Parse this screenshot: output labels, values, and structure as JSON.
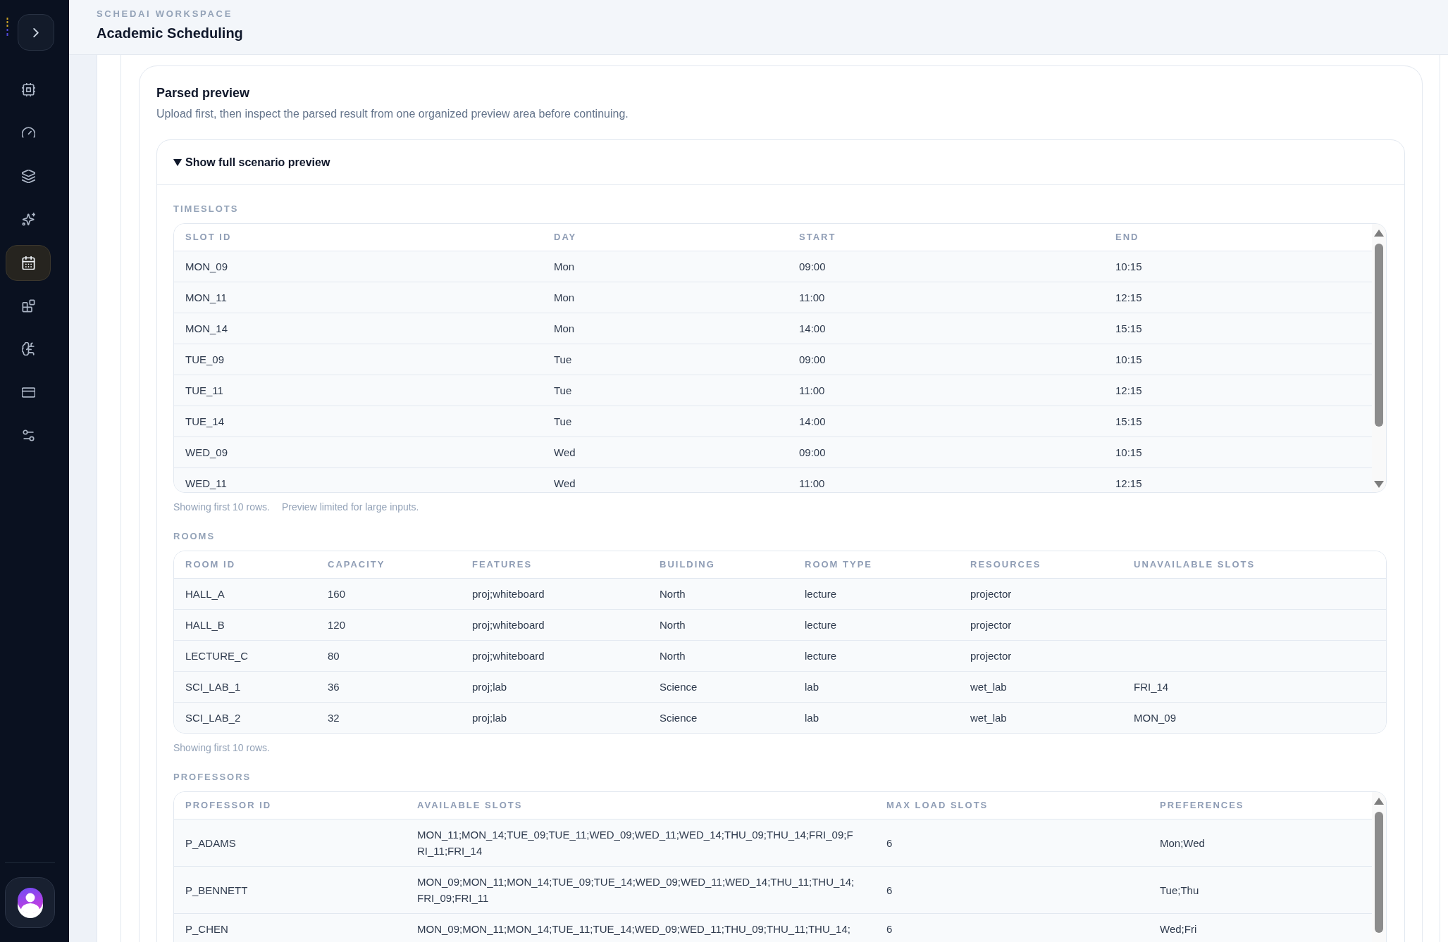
{
  "sidebar": {
    "items": [
      {
        "kind": "chip",
        "selected": false
      },
      {
        "kind": "gauge",
        "selected": false
      },
      {
        "kind": "layers",
        "selected": false
      },
      {
        "kind": "sparkles",
        "selected": false
      },
      {
        "kind": "calendar",
        "selected": true
      },
      {
        "kind": "blocks",
        "selected": false
      },
      {
        "kind": "brain",
        "selected": false
      },
      {
        "kind": "card",
        "selected": false
      },
      {
        "kind": "sliders",
        "selected": false
      }
    ]
  },
  "header": {
    "eyebrow": "SCHEDAI WORKSPACE",
    "title": "Academic Scheduling"
  },
  "preview": {
    "title": "Parsed preview",
    "subtitle": "Upload first, then inspect the parsed result from one organized preview area before continuing.",
    "toggle": {
      "label": "Show full scenario preview",
      "expanded": true
    },
    "sections": [
      {
        "title": "TIMESLOTS",
        "scrollable": true,
        "columns": [
          "SLOT ID",
          "DAY",
          "START",
          "END"
        ],
        "rows": [
          [
            "MON_09",
            "Mon",
            "09:00",
            "10:15"
          ],
          [
            "MON_11",
            "Mon",
            "11:00",
            "12:15"
          ],
          [
            "MON_14",
            "Mon",
            "14:00",
            "15:15"
          ],
          [
            "TUE_09",
            "Tue",
            "09:00",
            "10:15"
          ],
          [
            "TUE_11",
            "Tue",
            "11:00",
            "12:15"
          ],
          [
            "TUE_14",
            "Tue",
            "14:00",
            "15:15"
          ],
          [
            "WED_09",
            "Wed",
            "09:00",
            "10:15"
          ],
          [
            "WED_11",
            "Wed",
            "11:00",
            "12:15"
          ]
        ],
        "notes": [
          "Showing first 10 rows.",
          "Preview limited for large inputs."
        ]
      },
      {
        "title": "ROOMS",
        "scrollable": false,
        "columns": [
          "ROOM ID",
          "CAPACITY",
          "FEATURES",
          "BUILDING",
          "ROOM TYPE",
          "RESOURCES",
          "UNAVAILABLE SLOTS"
        ],
        "rows": [
          [
            "HALL_A",
            "160",
            "proj;whiteboard",
            "North",
            "lecture",
            "projector",
            null
          ],
          [
            "HALL_B",
            "120",
            "proj;whiteboard",
            "North",
            "lecture",
            "projector",
            null
          ],
          [
            "LECTURE_C",
            "80",
            "proj;whiteboard",
            "North",
            "lecture",
            "projector",
            null
          ],
          [
            "SCI_LAB_1",
            "36",
            "proj;lab",
            "Science",
            "lab",
            "wet_lab",
            "FRI_14"
          ],
          [
            "SCI_LAB_2",
            "32",
            "proj;lab",
            "Science",
            "lab",
            "wet_lab",
            "MON_09"
          ]
        ],
        "notes": [
          "Showing first 10 rows."
        ]
      },
      {
        "title": "PROFESSORS",
        "scrollable": true,
        "columns": [
          "PROFESSOR ID",
          "AVAILABLE SLOTS",
          "MAX LOAD SLOTS",
          "PREFERENCES"
        ],
        "rows": [
          [
            "P_ADAMS",
            "MON_11;MON_14;TUE_09;TUE_11;WED_09;WED_11;WED_14;THU_09;THU_14;FRI_09;FRI_11;FRI_14",
            "6",
            "Mon;Wed"
          ],
          [
            "P_BENNETT",
            "MON_09;MON_11;MON_14;TUE_09;TUE_14;WED_09;WED_11;WED_14;THU_11;THU_14;FRI_09;FRI_11",
            "6",
            "Tue;Thu"
          ],
          [
            "P_CHEN",
            "MON_09;MON_11;MON_14;TUE_11;TUE_14;WED_09;WED_11;THU_09;THU_11;THU_14;",
            "6",
            "Wed;Fri"
          ]
        ]
      }
    ]
  }
}
